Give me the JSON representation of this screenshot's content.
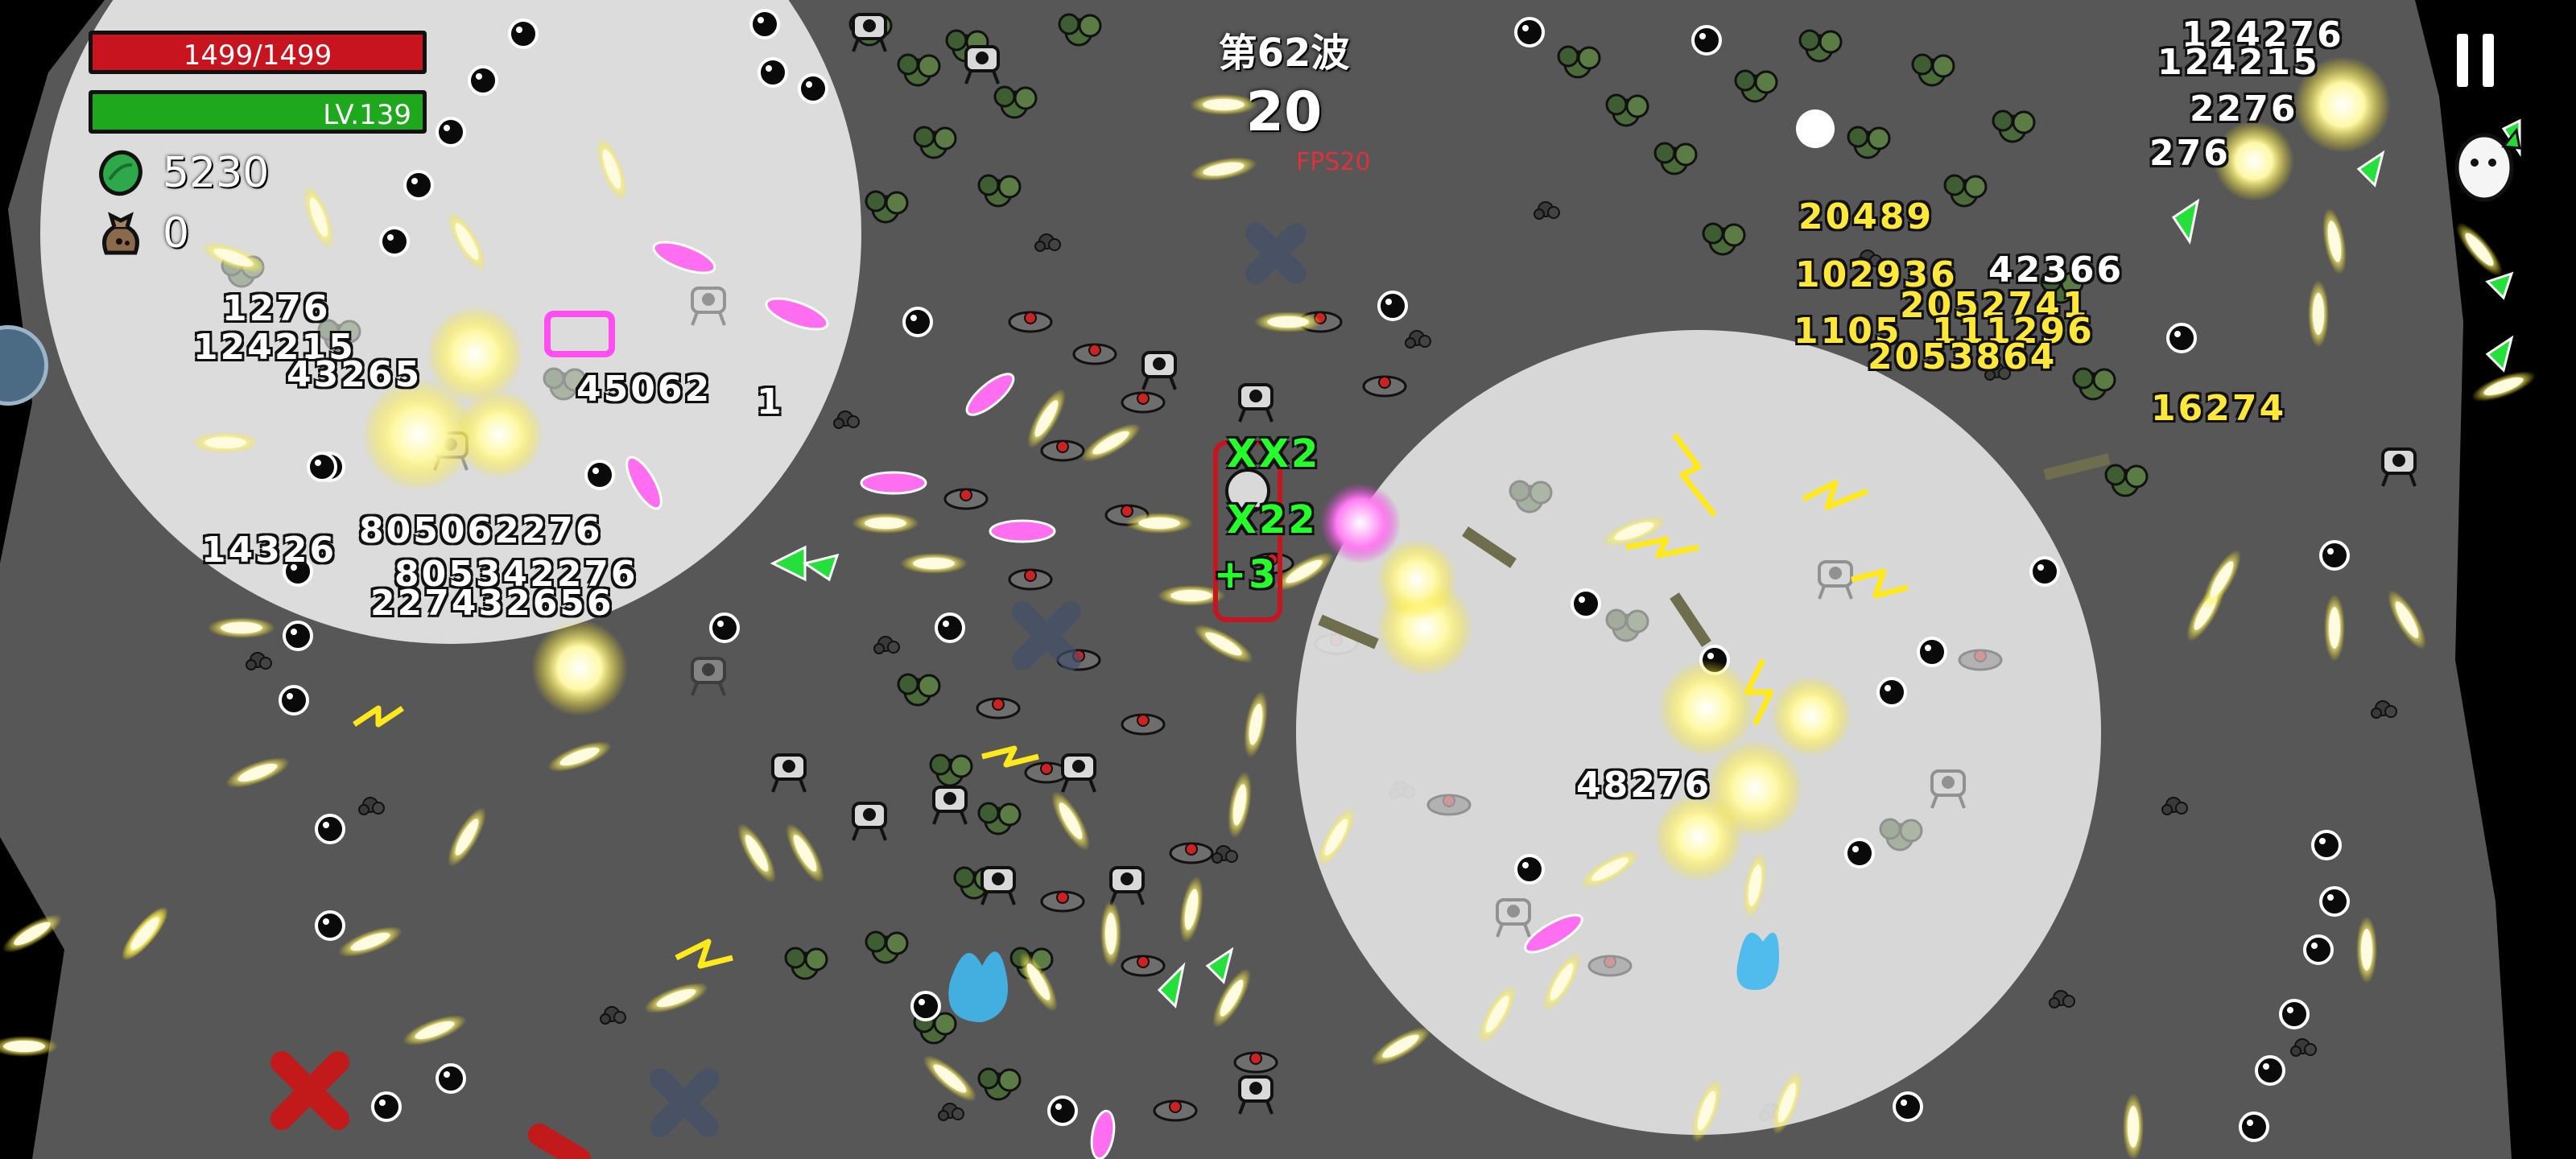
{
  "hud": {
    "hp_text": "1499/1499",
    "level_text": "LV.139",
    "coins": "5230",
    "bags": "0",
    "wave_label": "第62波",
    "wave_timer": "20",
    "fps": "FPS20"
  },
  "icons": {
    "coin": "green-gem-icon",
    "bag": "loot-bag-icon",
    "pause": "pause-icon",
    "egg": "egg-character-icon"
  },
  "colors": {
    "hp": "#c8141e",
    "xp": "#1ea81e",
    "damage_white": "#ffffff",
    "damage_yellow": "#ffe83a",
    "heal_green": "#25ff2a",
    "ground": "#5a5a5a",
    "aoe": "#e8e8e8"
  },
  "damage_numbers": [
    "124276",
    "124215",
    "2276",
    "276",
    "20489",
    "102936",
    "42366",
    "2052741",
    "1105",
    "111296",
    "2053864",
    "16274",
    "1276",
    "124215",
    "43265",
    "45062",
    "1",
    "14326",
    "805062276",
    "805342276",
    "227432656",
    "48276",
    "XX2",
    "X22",
    "+3"
  ]
}
